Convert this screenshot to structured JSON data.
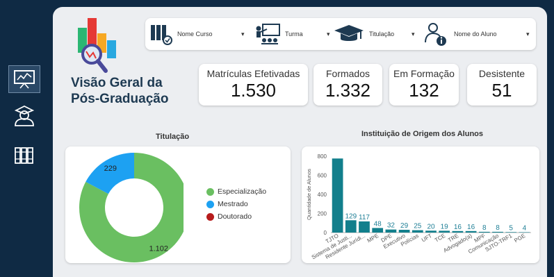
{
  "nav": {
    "items": [
      {
        "name": "dashboard-icon"
      },
      {
        "name": "student-icon"
      },
      {
        "name": "books-icon"
      }
    ]
  },
  "page": {
    "title_line1": "Visão Geral da",
    "title_line2": "Pós-Graduação"
  },
  "filters": [
    {
      "label": "Nome Curso",
      "icon": "books-icon"
    },
    {
      "label": "Turma",
      "icon": "classroom-icon"
    },
    {
      "label": "Titulação",
      "icon": "graduation-cap-icon"
    },
    {
      "label": "Nome do Aluno",
      "icon": "student-info-icon"
    }
  ],
  "kpis": [
    {
      "label": "Matrículas Efetivadas",
      "value": "1.530"
    },
    {
      "label": "Formados",
      "value": "1.332"
    },
    {
      "label": "Em Formação",
      "value": "132"
    },
    {
      "label": "Desistente",
      "value": "51"
    }
  ],
  "colors": {
    "specializacao": "#6abf61",
    "mestrado": "#1da1f2",
    "doutorado": "#b71c1c",
    "bar": "#127f8c"
  },
  "chart_data": [
    {
      "type": "pie",
      "title": "Titulação",
      "slices": [
        {
          "label": "Especialização",
          "value": 1102,
          "display": "1.102",
          "color": "#6abf61"
        },
        {
          "label": "Mestrado",
          "value": 229,
          "display": "229",
          "color": "#1da1f2"
        },
        {
          "label": "Doutorado",
          "value": 0,
          "display": "",
          "color": "#b71c1c"
        }
      ],
      "legend": "right"
    },
    {
      "type": "bar",
      "title": "Instituição de Origem dos Alunos",
      "ylabel": "Quantidade de Alunos",
      "ylim": [
        0,
        800
      ],
      "yticks": [
        "0",
        "200",
        "400",
        "600",
        "800"
      ],
      "categories": [
        "TJTO",
        "Sistema de Justi...",
        "Residente Jurídi...",
        "MPE",
        "DPE",
        "Executivo",
        "Polícias",
        "UFT",
        "TCE",
        "TRE",
        "Advogado(a)",
        "MPF",
        "Comunicação",
        "SJTO-TRF1",
        "PGE"
      ],
      "values": [
        776,
        129,
        117,
        48,
        32,
        29,
        25,
        20,
        19,
        16,
        16,
        8,
        8,
        5,
        4
      ],
      "labels": [
        "",
        "129",
        "117",
        "48",
        "32",
        "29",
        "25",
        "20",
        "19",
        "16",
        "16",
        "8",
        "8",
        "5",
        "4"
      ]
    }
  ]
}
